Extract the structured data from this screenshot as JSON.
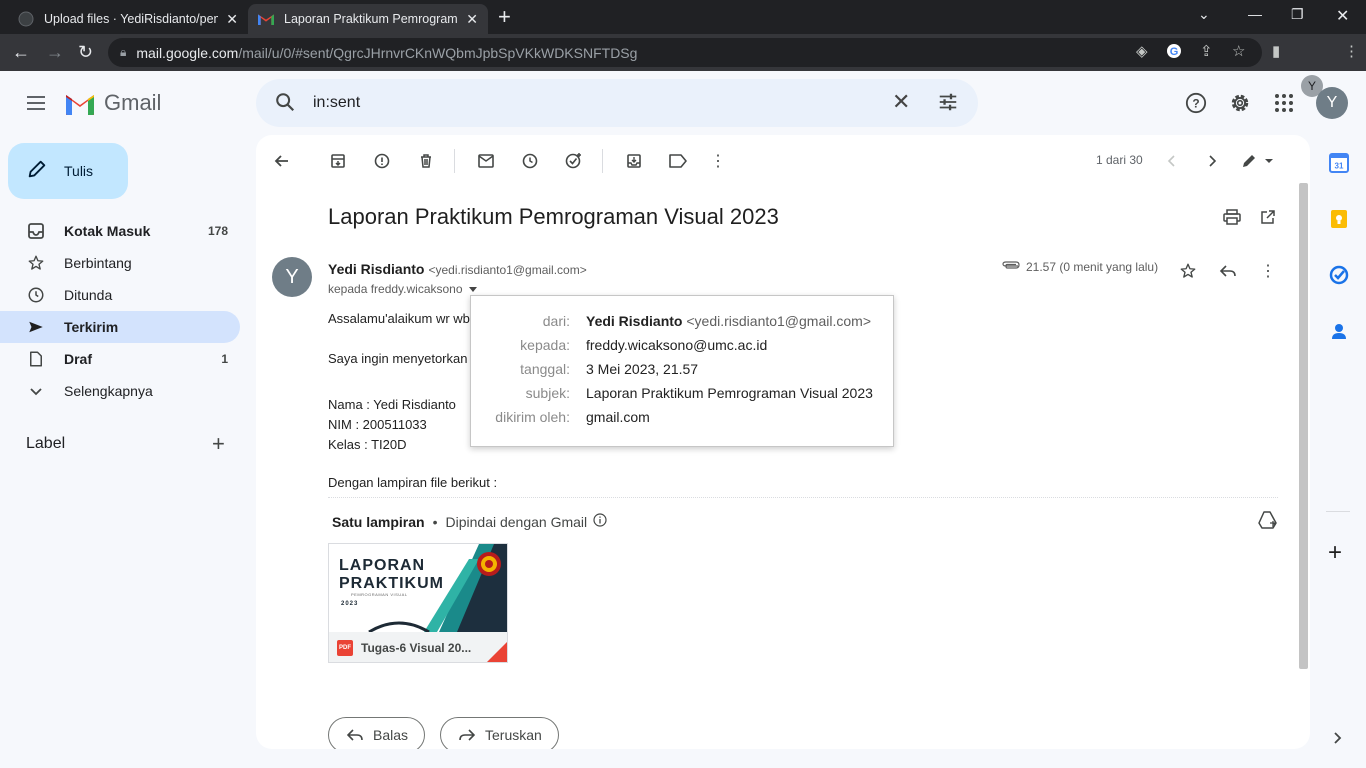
{
  "browser": {
    "tabs": [
      {
        "title": "Upload files · YediRisdianto/pem",
        "active": false
      },
      {
        "title": "Laporan Praktikum Pemrograman",
        "active": true
      }
    ],
    "url_domain": "mail.google.com",
    "url_path": "/mail/u/0/#sent/QgrcJHrnvrCKnWQbmJpbSpVKkWDKSNFTDSg",
    "profile_initial": "Y"
  },
  "gmail": {
    "logo_text": "Gmail",
    "search_value": "in:sent",
    "account_initial": "Y"
  },
  "sidebar": {
    "compose_label": "Tulis",
    "items": [
      {
        "label": "Kotak Masuk",
        "count": "178",
        "icon": "inbox-icon"
      },
      {
        "label": "Berbintang",
        "count": "",
        "icon": "star-icon"
      },
      {
        "label": "Ditunda",
        "count": "",
        "icon": "clock-icon"
      },
      {
        "label": "Terkirim",
        "count": "",
        "icon": "send-icon"
      },
      {
        "label": "Draf",
        "count": "1",
        "icon": "draft-icon"
      },
      {
        "label": "Selengkapnya",
        "count": "",
        "icon": "chevron-down-icon"
      }
    ],
    "labels_header": "Label"
  },
  "toolbar": {
    "pager": "1 dari 30"
  },
  "message": {
    "subject": "Laporan Praktikum Pemrograman Visual 2023",
    "sender_initial": "Y",
    "sender_name": "Yedi Risdianto",
    "sender_email": "<yedi.risdianto1@gmail.com>",
    "to_line": "kepada freddy.wicaksono",
    "time": "21.57 (0 menit yang lalu)",
    "body_lines": [
      "Assalamu'alaikum wr wb",
      "",
      "Saya ingin menyetorkan",
      "",
      "Nama : Yedi Risdianto",
      "NIM : 200511033",
      "Kelas : TI20D",
      "",
      "Dengan lampiran file berikut :"
    ],
    "attachment_count_label": "Satu lampiran",
    "attachment_scan_label": "Dipindai dengan Gmail",
    "attachment": {
      "thumb_line1": "LAPORAN",
      "thumb_line2": "PRAKTIKUM",
      "thumb_sub": "PEMROGRAMAN VISUAL",
      "thumb_year": "2023",
      "file_type": "PDF",
      "file_name": "Tugas-6 Visual 20..."
    },
    "reply_label": "Balas",
    "forward_label": "Teruskan"
  },
  "popup": {
    "rows": [
      {
        "key": "dari:",
        "value_name": "Yedi Risdianto",
        "value_email": "<yedi.risdianto1@gmail.com>"
      },
      {
        "key": "kepada:",
        "value": "freddy.wicaksono@umc.ac.id"
      },
      {
        "key": "tanggal:",
        "value": "3 Mei 2023, 21.57"
      },
      {
        "key": "subjek:",
        "value": "Laporan Praktikum Pemrograman Visual 2023"
      },
      {
        "key": "dikirim oleh:",
        "value": "gmail.com"
      }
    ]
  },
  "colors": {
    "accent_active_nav": "#d3e3fd",
    "compose_bg": "#c2e7ff",
    "search_bg": "#eaf1fb",
    "page_bg": "#f6f8fc",
    "pdf_red": "#ea4335",
    "calendar_day": "31"
  }
}
